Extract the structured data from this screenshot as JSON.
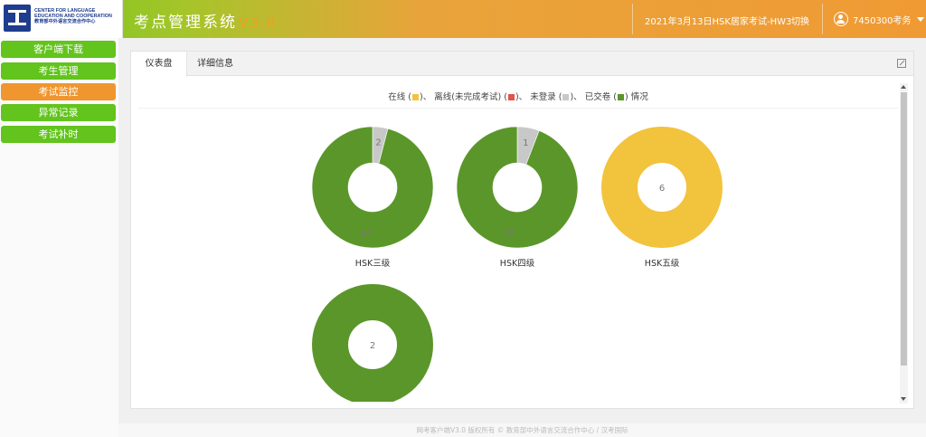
{
  "header": {
    "logo_en_line1": "CENTER FOR LANGUAGE",
    "logo_en_line2": "EDUCATION AND COOPERATION",
    "logo_cn": "教育部中外语言交流合作中心",
    "title": "考点管理系统",
    "version": "V3.0",
    "exam_name": "2021年3月13日HSK居家考试-HW3",
    "switch_label": "切换",
    "user_label": "7450300考务",
    "icons": [
      "user-icon",
      "chevron-down-icon"
    ]
  },
  "sidebar": {
    "items": [
      {
        "label": "客户端下载",
        "active": false
      },
      {
        "label": "考生管理",
        "active": false
      },
      {
        "label": "考试监控",
        "active": true
      },
      {
        "label": "异常记录",
        "active": false
      },
      {
        "label": "考试补时",
        "active": false
      }
    ]
  },
  "tabs": [
    {
      "label": "仪表盘",
      "active": true
    },
    {
      "label": "详细信息",
      "active": false
    }
  ],
  "legend": {
    "online": "在线",
    "offline": "离线(未完成考试)",
    "not_logged": "未登录",
    "submitted": "已交卷",
    "suffix": "情况",
    "sep": "、"
  },
  "colors": {
    "online": "#f2c33c",
    "offline": "#e2534a",
    "not_logged": "#c8c8c8",
    "submitted": "#5b962a",
    "menu_green": "#62c41c",
    "menu_active": "#f0962e"
  },
  "chart_data": {
    "type": "pie",
    "style": "donut",
    "title": "在线 ()、 离线(未完成考试) ()、 未登录 ()、 已交卷 () 情况",
    "charts": [
      {
        "label": "HSK三级",
        "segments": [
          {
            "series": "未登录",
            "value": 2
          },
          {
            "series": "已交卷",
            "value": 47
          }
        ]
      },
      {
        "label": "HSK四级",
        "segments": [
          {
            "series": "未登录",
            "value": 1
          },
          {
            "series": "已交卷",
            "value": 16
          }
        ]
      },
      {
        "label": "HSK五级",
        "segments": [
          {
            "series": "在线",
            "value": 6
          }
        ]
      },
      {
        "label": "",
        "segments": [
          {
            "series": "已交卷",
            "value": 2
          }
        ]
      }
    ]
  },
  "footer": {
    "text": "网考客户端V3.0 版权所有 © 教育部中外语言交流合作中心 / 汉考国际"
  }
}
